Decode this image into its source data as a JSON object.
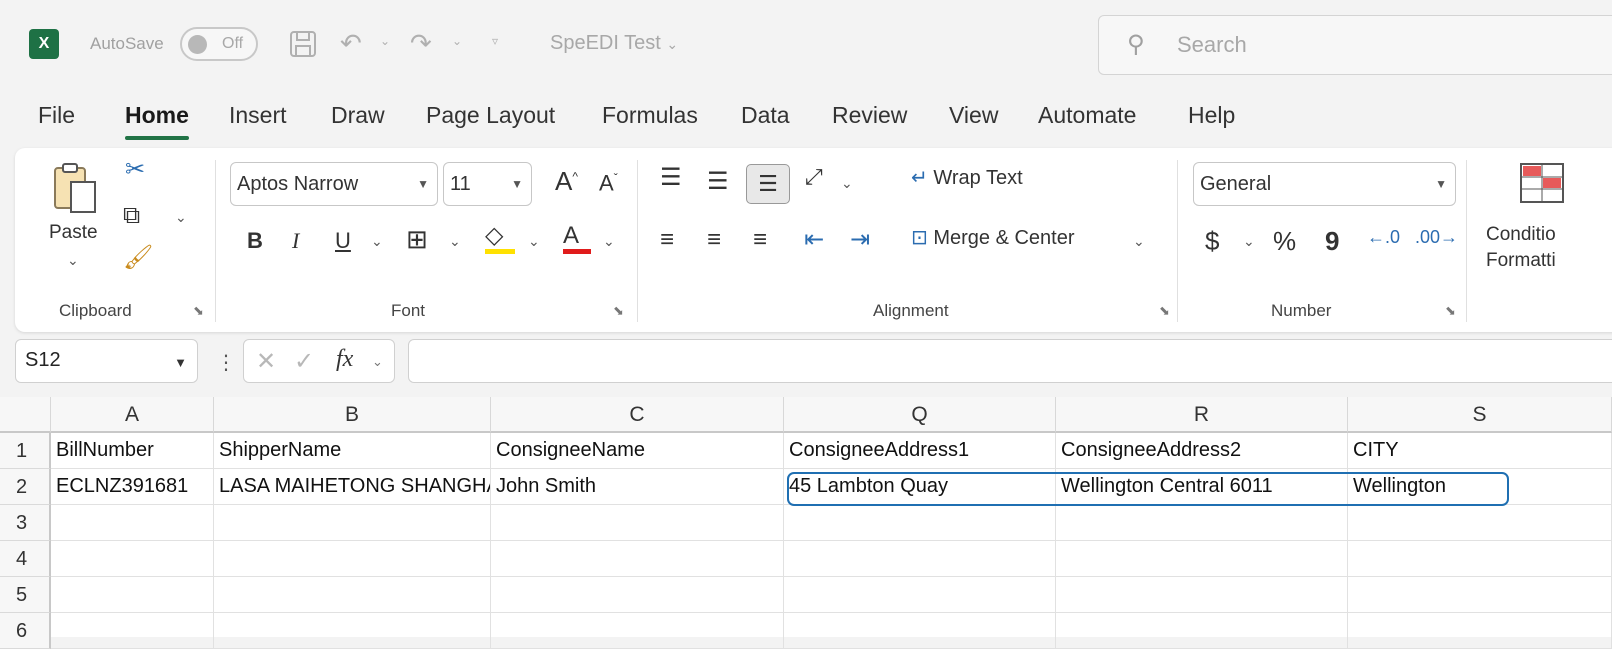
{
  "titlebar": {
    "logo": "X",
    "autosave_label": "AutoSave",
    "autosave_state": "Off",
    "doc_title": "SpeEDI Test",
    "search_placeholder": "Search"
  },
  "menu": [
    "File",
    "Home",
    "Insert",
    "Draw",
    "Page Layout",
    "Formulas",
    "Data",
    "Review",
    "View",
    "Automate",
    "Help"
  ],
  "ribbon": {
    "clipboard": {
      "paste": "Paste",
      "label": "Clipboard"
    },
    "font": {
      "name": "Aptos Narrow",
      "size": "11",
      "label": "Font",
      "bold": "B",
      "italic": "I",
      "underline": "U"
    },
    "alignment": {
      "wrap_text": "Wrap Text",
      "merge_center": "Merge & Center",
      "label": "Alignment"
    },
    "number": {
      "format": "General",
      "label": "Number",
      "currency": "$",
      "percent": "%",
      "comma": "9"
    },
    "styles": {
      "cond_format_line1": "Conditio",
      "cond_format_line2": "Formatti"
    }
  },
  "formula_bar": {
    "name_box": "S12",
    "fx": "fx",
    "value": ""
  },
  "sheet": {
    "columns": [
      "A",
      "B",
      "C",
      "Q",
      "R",
      "S"
    ],
    "row_numbers": [
      "1",
      "2",
      "3",
      "4",
      "5",
      "6"
    ],
    "rows": [
      [
        "BillNumber",
        "ShipperName",
        "ConsigneeName",
        "ConsigneeAddress1",
        "ConsigneeAddress2",
        "CITY"
      ],
      [
        "ECLNZ391681",
        "LASA MAIHETONG SHANGHAI",
        "John Smith",
        "45 Lambton Quay",
        "Wellington Central  6011",
        "Wellington"
      ]
    ]
  },
  "colors": {
    "excel_green": "#217346",
    "selection_blue": "#1f6fb2"
  }
}
